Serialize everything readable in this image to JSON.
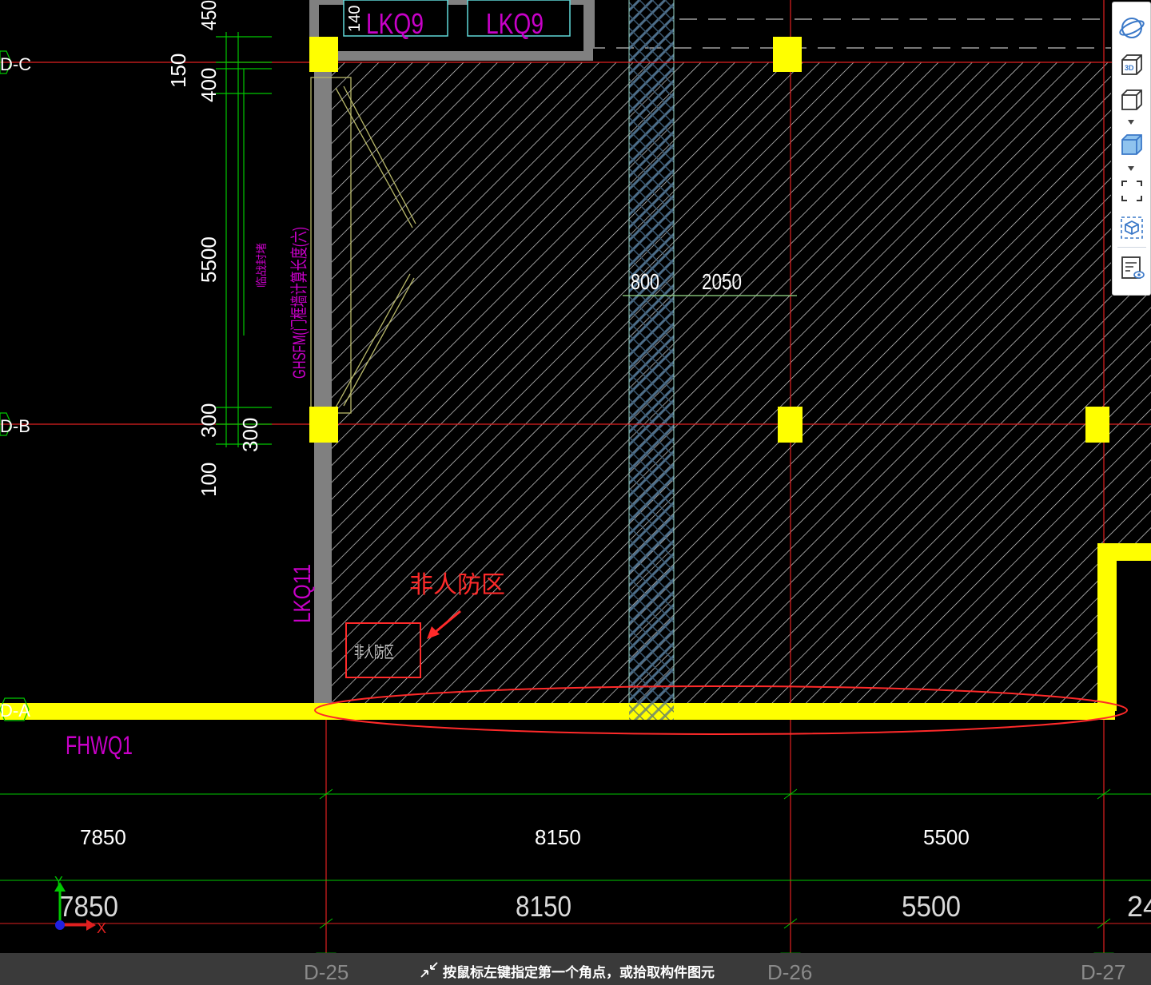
{
  "axes": {
    "rows": [
      "D-C",
      "D-B",
      "D-A"
    ],
    "cols": [
      "D-25",
      "D-26",
      "D-27"
    ]
  },
  "vertical_dims": [
    "450",
    "150",
    "400",
    "5500",
    "300",
    "300",
    "100"
  ],
  "labels": {
    "lkq9_a": "LKQ9",
    "lkq9_b": "LKQ9",
    "lkq11": "LKQ11",
    "fhwq1": "FHWQ1",
    "ghsfm": "GHSFM(门框墙计算长度(六)",
    "small_vert": "临战封堵",
    "top_small": "140",
    "dim_800": "800",
    "dim_2050": "2050",
    "non_civil_small": "非人防区"
  },
  "annotation": {
    "text": "非人防区",
    "color": "#ff2a2a"
  },
  "bottom_dims": {
    "row1": [
      "7850",
      "8150",
      "5500"
    ],
    "row2": [
      "7850",
      "8150",
      "5500",
      "24"
    ]
  },
  "ucs": {
    "y": "Y",
    "x": "X"
  },
  "toolbar": {
    "items": [
      "orbit-icon",
      "3d-view-icon",
      "box-view-icon",
      "shaded-box-icon",
      "full-screen-icon",
      "component-view-icon",
      "properties-view-icon"
    ]
  },
  "status": {
    "prompt": "按鼠标左键指定第一个角点，或拾取构件图元"
  },
  "colors": {
    "column": "#ffff00",
    "axis": "#ff2a2a",
    "dim": "#00c800",
    "purple": "#c800c8",
    "wall": "#808080",
    "hatch": "#e6e6e6"
  }
}
